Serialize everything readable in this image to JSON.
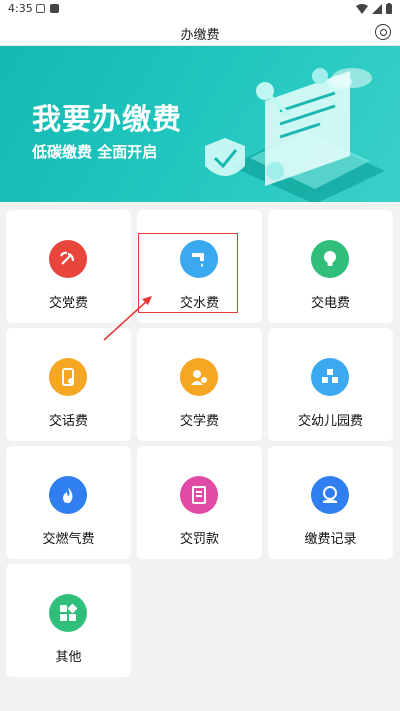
{
  "status_bar": {
    "time": "4:35"
  },
  "header": {
    "title": "办缴费"
  },
  "banner": {
    "title": "我要办缴费",
    "subtitle": "低碳缴费 全面开启"
  },
  "tiles": [
    {
      "label": "交党费",
      "icon": "party-emblem-icon",
      "color": "#e8453c"
    },
    {
      "label": "交水费",
      "icon": "water-tap-icon",
      "color": "#3aa9f0"
    },
    {
      "label": "交电费",
      "icon": "lightbulb-icon",
      "color": "#2fbf7a"
    },
    {
      "label": "交话费",
      "icon": "phone-icon",
      "color": "#f5a623"
    },
    {
      "label": "交学费",
      "icon": "student-icon",
      "color": "#f5a623"
    },
    {
      "label": "交幼儿园费",
      "icon": "kindergarten-icon",
      "color": "#3aa9f0"
    },
    {
      "label": "交燃气费",
      "icon": "flame-icon",
      "color": "#2f7ff0"
    },
    {
      "label": "交罚款",
      "icon": "ticket-icon",
      "color": "#e24aa8"
    },
    {
      "label": "缴费记录",
      "icon": "record-icon",
      "color": "#2f7ff0"
    },
    {
      "label": "其他",
      "icon": "apps-icon",
      "color": "#2fbf7a"
    }
  ]
}
